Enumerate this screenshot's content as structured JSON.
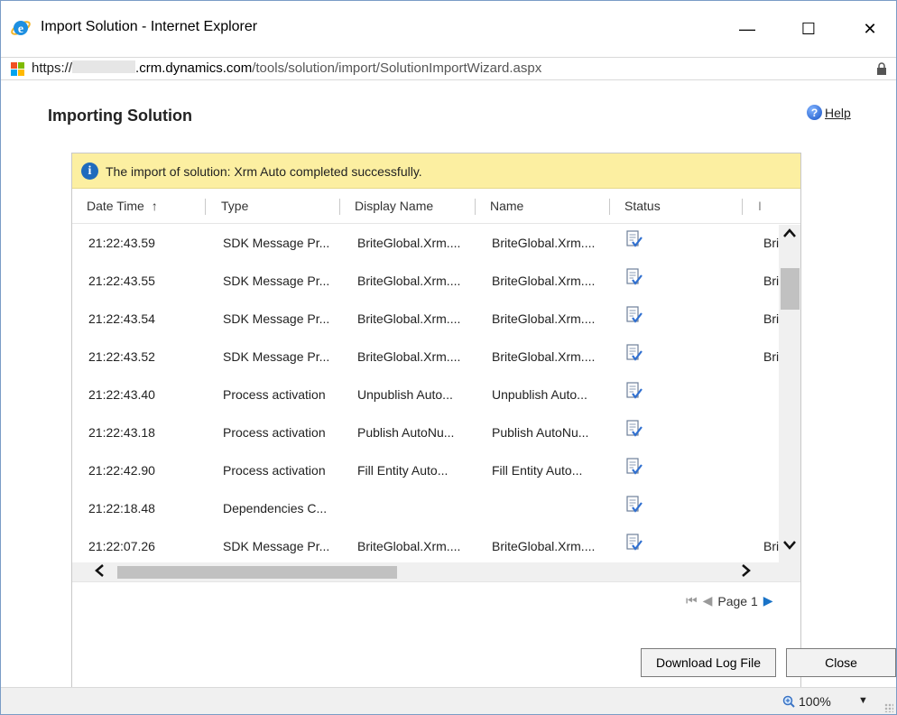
{
  "window": {
    "title": "Import Solution - Internet Explorer",
    "minimize": "—",
    "maximize": "☐",
    "close": "✕"
  },
  "address": {
    "protocol": "https://",
    "domain_suffix": ".crm.dynamics.com",
    "path": "/tools/solution/import/SolutionImportWizard.aspx"
  },
  "page": {
    "title": "Importing Solution",
    "help": "Help"
  },
  "banner": {
    "message": "The import of solution: Xrm Auto completed successfully."
  },
  "columns": [
    "Date Time",
    "Type",
    "Display Name",
    "Name",
    "Status",
    "I"
  ],
  "sort_indicator": "↑",
  "rows": [
    {
      "time": "21:22:43.59",
      "type": "SDK Message Pr...",
      "display": "BriteGlobal.Xrm....",
      "name": "BriteGlobal.Xrm....",
      "extra": "Bri"
    },
    {
      "time": "21:22:43.55",
      "type": "SDK Message Pr...",
      "display": "BriteGlobal.Xrm....",
      "name": "BriteGlobal.Xrm....",
      "extra": "Bri"
    },
    {
      "time": "21:22:43.54",
      "type": "SDK Message Pr...",
      "display": "BriteGlobal.Xrm....",
      "name": "BriteGlobal.Xrm....",
      "extra": "Bri"
    },
    {
      "time": "21:22:43.52",
      "type": "SDK Message Pr...",
      "display": "BriteGlobal.Xrm....",
      "name": "BriteGlobal.Xrm....",
      "extra": "Bri"
    },
    {
      "time": "21:22:43.40",
      "type": "Process activation",
      "display": "Unpublish Auto...",
      "name": "Unpublish Auto...",
      "extra": ""
    },
    {
      "time": "21:22:43.18",
      "type": "Process activation",
      "display": "Publish AutoNu...",
      "name": "Publish AutoNu...",
      "extra": ""
    },
    {
      "time": "21:22:42.90",
      "type": "Process activation",
      "display": "Fill Entity Auto...",
      "name": "Fill Entity Auto...",
      "extra": ""
    },
    {
      "time": "21:22:18.48",
      "type": "Dependencies C...",
      "display": "",
      "name": "",
      "extra": ""
    },
    {
      "time": "21:22:07.26",
      "type": "SDK Message Pr...",
      "display": "BriteGlobal.Xrm....",
      "name": "BriteGlobal.Xrm....",
      "extra": "Bri"
    }
  ],
  "pager": {
    "first": "⏮",
    "prev": "◀",
    "label": "Page 1",
    "next": "▶"
  },
  "buttons": {
    "download": "Download Log File",
    "close": "Close"
  },
  "statusbar": {
    "zoom": "100%",
    "zoom_caret": "▼"
  },
  "colors": {
    "banner_bg": "#fcefa1",
    "accent": "#1f6bbd"
  }
}
